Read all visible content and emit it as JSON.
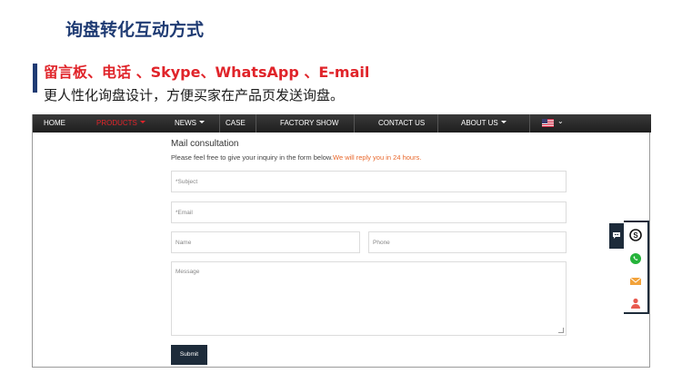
{
  "slide": {
    "title": "询盘转化互动方式",
    "channels": "留言板、电话 、Skype、WhatsApp 、E-mail",
    "subtitle": "更人性化询盘设计，方便买家在产品页发送询盘。"
  },
  "nav": {
    "items": [
      {
        "label": "HOME",
        "has_caret": false,
        "active": false
      },
      {
        "label": "PRODUCTS",
        "has_caret": true,
        "active": true
      },
      {
        "label": "NEWS",
        "has_caret": true,
        "active": false
      },
      {
        "label": "CASE",
        "has_caret": false,
        "active": false
      },
      {
        "label": "FACTORY SHOW",
        "has_caret": false,
        "active": false
      },
      {
        "label": "CONTACT US",
        "has_caret": false,
        "active": false
      },
      {
        "label": "ABOUT US",
        "has_caret": true,
        "active": false
      }
    ],
    "language_icon": "us-flag-icon"
  },
  "form": {
    "title": "Mail consultation",
    "description": "Please feel free to give your inquiry in the form below.",
    "reply_note": "We will reply you in 24 hours.",
    "subject_placeholder": "*Subject",
    "email_placeholder": "*Email",
    "name_placeholder": "Name",
    "phone_placeholder": "Phone",
    "message_placeholder": "Message",
    "submit_label": "Submit"
  },
  "contact_widget": {
    "icons": [
      "chat-icon",
      "skype-icon",
      "whatsapp-icon",
      "email-icon",
      "contact-person-icon"
    ]
  },
  "colors": {
    "title_blue": "#1f3b73",
    "accent_red": "#e0242a",
    "reply_orange": "#e8672b",
    "navy_button": "#1d2b3a"
  }
}
